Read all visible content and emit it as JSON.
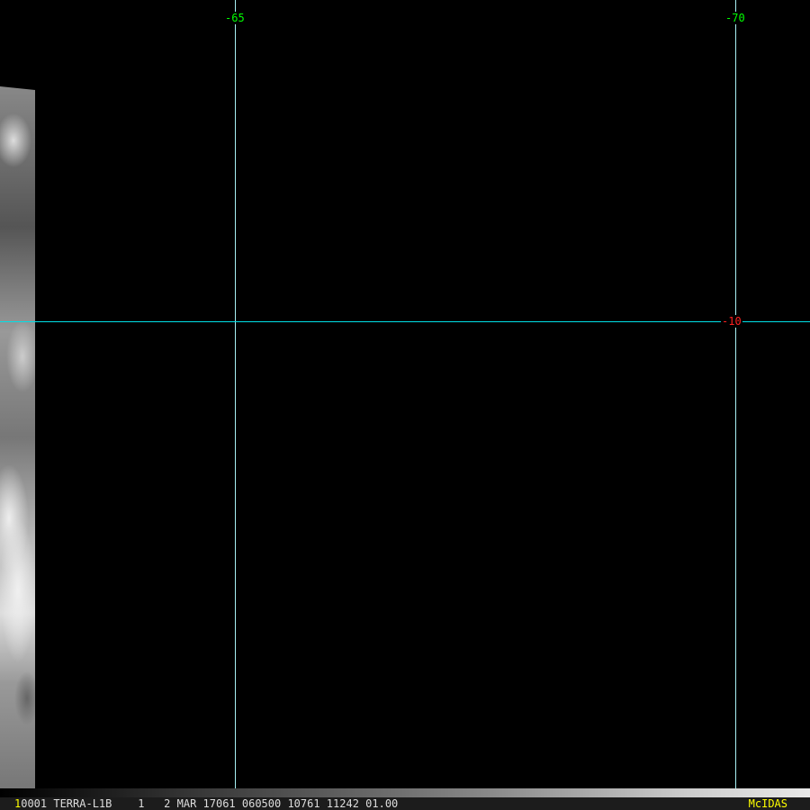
{
  "grid": {
    "lon_labels": [
      "-65",
      "-70"
    ],
    "lat_labels": [
      "-10"
    ],
    "line_color": "#a8f0f4",
    "lat_line_color": "#00e0e8"
  },
  "status": {
    "frame": "1",
    "text": "0001 TERRA-L1B    1   2 MAR 17061 060500 10761 11242 01.00",
    "brand": "McIDAS"
  }
}
